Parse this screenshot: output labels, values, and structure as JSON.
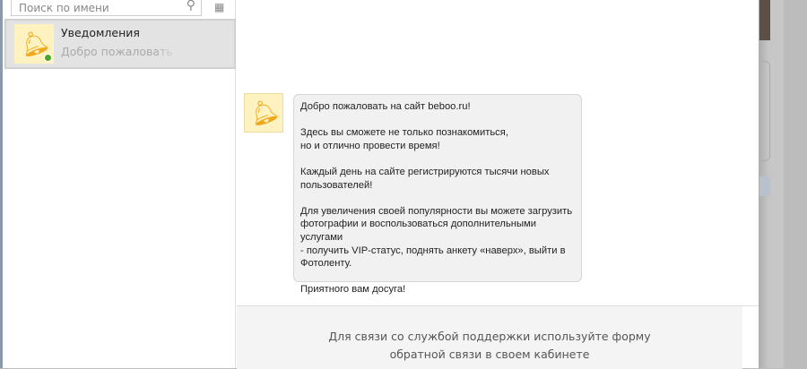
{
  "sidebar": {
    "search_placeholder": "Поиск по имени",
    "dialogs": [
      {
        "name": "Уведомления",
        "preview": "Добро пожаловать на сайт beboo.ru!",
        "online": true
      }
    ]
  },
  "message": {
    "paragraphs": [
      "Добро пожаловать на сайт beboo.ru!",
      "Здесь вы сможете не только познакомиться,\nно и отлично провести время!",
      "Каждый день на сайте регистрируются тысячи новых\nпользователей!",
      "Для увеличения своей популярности вы можете загрузить\nфотографии и воспользоваться дополнительными услугами\n- получить VIP-статус, поднять анкету «наверх», выйти в\nФотоленту.",
      "Приятного вам досуга!"
    ]
  },
  "footer": {
    "text": "Для связи со службой поддержки используйте форму обратной связи в своем кабинете"
  },
  "colors": {
    "accent": "#f0a81c",
    "online": "#4aa52a",
    "modal_border": "#5d86b8"
  }
}
